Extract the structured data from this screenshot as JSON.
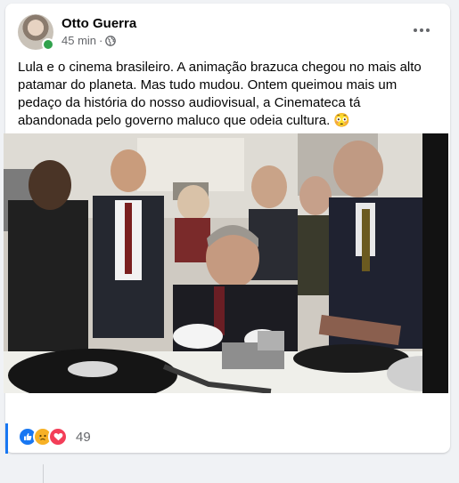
{
  "post": {
    "author": "Otto Guerra",
    "time": "45 min",
    "separator": "·",
    "text": "Lula e o cinema brasileiro. A animação brazuca chegou no mais alto patamar do planeta. Mas tudo mudou. Ontem queimou mais um pedaço da história do nosso audiovisual, a Cinemateca tá abandonada pelo governo maluco que odeia cultura. 😳",
    "reaction_count": "49"
  },
  "icons": {
    "audience": "globe-icon",
    "more": "more-options-icon",
    "reactions": [
      "like-icon",
      "sad-icon",
      "love-icon"
    ]
  },
  "colors": {
    "like": "#1877f2",
    "sad": "#f7b125",
    "love": "#f33e58",
    "online": "#31a24c"
  }
}
